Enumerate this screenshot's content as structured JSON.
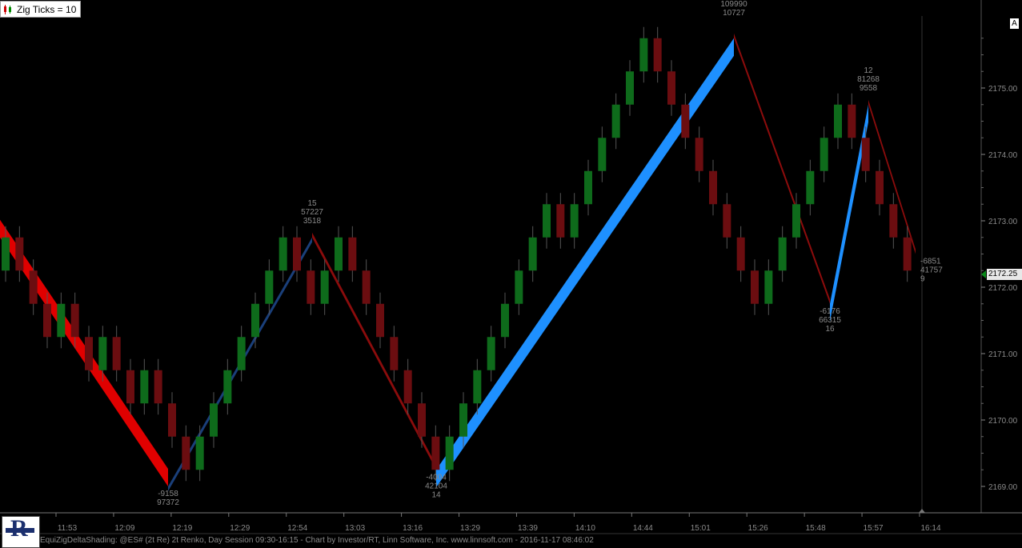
{
  "indicator": {
    "label": "Zig Ticks = 10"
  },
  "a_button": "A",
  "current_price": "2172.25",
  "footer": "EquiZigDeltaShading: @ES# (2t Re) 2t Renko, Day Session 09:30-16:15 - Chart by Investor/RT, Linn Software, Inc. www.linnsoft.com - 2016-11-17 08:46:02",
  "colors": {
    "up_brick": "#0e6b1b",
    "down_brick": "#6b0d10",
    "zig_down_bright": "#e00000",
    "zig_up_bright": "#1e90ff",
    "zig_down_dark": "#8b0c0c",
    "zig_up_dark": "#1a3f7a",
    "axis_text": "#8a8a8a"
  },
  "chart_data": {
    "type": "renko",
    "y_ticks": [
      "2175.00",
      "2174.00",
      "2173.00",
      "2172.00",
      "2171.00",
      "2170.00",
      "2169.00"
    ],
    "y_tick_values": [
      2175,
      2174,
      2173,
      2172,
      2171,
      2170,
      2169
    ],
    "x_ticks": [
      "11:53",
      "12:09",
      "12:19",
      "12:29",
      "12:54",
      "13:03",
      "13:16",
      "13:29",
      "13:39",
      "14:10",
      "14:44",
      "15:01",
      "15:26",
      "15:48",
      "15:57",
      "16:14"
    ],
    "ylim": [
      2168.6,
      2176.0
    ],
    "zig_points": [
      {
        "price": 2172.75,
        "labels": []
      },
      {
        "price": 2169.0,
        "labels": [
          "-9158",
          "97372"
        ]
      },
      {
        "price": 2172.75,
        "labels": [
          "15",
          "57227",
          "3518"
        ]
      },
      {
        "price": 2169.25,
        "labels": [
          "-4004",
          "42104",
          "14"
        ]
      },
      {
        "price": 2175.75,
        "labels": [
          "109990",
          "10727"
        ]
      },
      {
        "price": 2171.75,
        "labels": [
          "-6176",
          "66315",
          "16"
        ]
      },
      {
        "price": 2174.75,
        "labels": [
          "12",
          "81268",
          "9558"
        ]
      },
      {
        "price": 2172.5,
        "labels": [
          "-6851",
          "41757",
          "9"
        ]
      }
    ],
    "segments": [
      {
        "direction": "down",
        "intensity": "bright"
      },
      {
        "direction": "up",
        "intensity": "dark"
      },
      {
        "direction": "down",
        "intensity": "dark"
      },
      {
        "direction": "up",
        "intensity": "bright"
      },
      {
        "direction": "down",
        "intensity": "dark"
      },
      {
        "direction": "up",
        "intensity": "bright"
      },
      {
        "direction": "down",
        "intensity": "dark"
      }
    ],
    "bricks": [
      {
        "o": 2172.25,
        "c": 2172.75
      },
      {
        "o": 2172.75,
        "c": 2172.25
      },
      {
        "o": 2172.25,
        "c": 2171.75
      },
      {
        "o": 2171.75,
        "c": 2171.25
      },
      {
        "o": 2171.25,
        "c": 2171.75
      },
      {
        "o": 2171.75,
        "c": 2171.25
      },
      {
        "o": 2171.25,
        "c": 2170.75
      },
      {
        "o": 2170.75,
        "c": 2171.25
      },
      {
        "o": 2171.25,
        "c": 2170.75
      },
      {
        "o": 2170.75,
        "c": 2170.25
      },
      {
        "o": 2170.25,
        "c": 2170.75
      },
      {
        "o": 2170.75,
        "c": 2170.25
      },
      {
        "o": 2170.25,
        "c": 2169.75
      },
      {
        "o": 2169.75,
        "c": 2169.25
      },
      {
        "o": 2169.25,
        "c": 2169.75
      },
      {
        "o": 2169.75,
        "c": 2170.25
      },
      {
        "o": 2170.25,
        "c": 2170.75
      },
      {
        "o": 2170.75,
        "c": 2171.25
      },
      {
        "o": 2171.25,
        "c": 2171.75
      },
      {
        "o": 2171.75,
        "c": 2172.25
      },
      {
        "o": 2172.25,
        "c": 2172.75
      },
      {
        "o": 2172.75,
        "c": 2172.25
      },
      {
        "o": 2172.25,
        "c": 2171.75
      },
      {
        "o": 2171.75,
        "c": 2172.25
      },
      {
        "o": 2172.25,
        "c": 2172.75
      },
      {
        "o": 2172.75,
        "c": 2172.25
      },
      {
        "o": 2172.25,
        "c": 2171.75
      },
      {
        "o": 2171.75,
        "c": 2171.25
      },
      {
        "o": 2171.25,
        "c": 2170.75
      },
      {
        "o": 2170.75,
        "c": 2170.25
      },
      {
        "o": 2170.25,
        "c": 2169.75
      },
      {
        "o": 2169.75,
        "c": 2169.25
      },
      {
        "o": 2169.25,
        "c": 2169.75
      },
      {
        "o": 2169.75,
        "c": 2170.25
      },
      {
        "o": 2170.25,
        "c": 2170.75
      },
      {
        "o": 2170.75,
        "c": 2171.25
      },
      {
        "o": 2171.25,
        "c": 2171.75
      },
      {
        "o": 2171.75,
        "c": 2172.25
      },
      {
        "o": 2172.25,
        "c": 2172.75
      },
      {
        "o": 2172.75,
        "c": 2173.25
      },
      {
        "o": 2173.25,
        "c": 2172.75
      },
      {
        "o": 2172.75,
        "c": 2173.25
      },
      {
        "o": 2173.25,
        "c": 2173.75
      },
      {
        "o": 2173.75,
        "c": 2174.25
      },
      {
        "o": 2174.25,
        "c": 2174.75
      },
      {
        "o": 2174.75,
        "c": 2175.25
      },
      {
        "o": 2175.25,
        "c": 2175.75
      },
      {
        "o": 2175.75,
        "c": 2175.25
      },
      {
        "o": 2175.25,
        "c": 2174.75
      },
      {
        "o": 2174.75,
        "c": 2174.25
      },
      {
        "o": 2174.25,
        "c": 2173.75
      },
      {
        "o": 2173.75,
        "c": 2173.25
      },
      {
        "o": 2173.25,
        "c": 2172.75
      },
      {
        "o": 2172.75,
        "c": 2172.25
      },
      {
        "o": 2172.25,
        "c": 2171.75
      },
      {
        "o": 2171.75,
        "c": 2172.25
      },
      {
        "o": 2172.25,
        "c": 2172.75
      },
      {
        "o": 2172.75,
        "c": 2173.25
      },
      {
        "o": 2173.25,
        "c": 2173.75
      },
      {
        "o": 2173.75,
        "c": 2174.25
      },
      {
        "o": 2174.25,
        "c": 2174.75
      },
      {
        "o": 2174.75,
        "c": 2174.25
      },
      {
        "o": 2174.25,
        "c": 2173.75
      },
      {
        "o": 2173.75,
        "c": 2173.25
      },
      {
        "o": 2173.25,
        "c": 2172.75
      },
      {
        "o": 2172.75,
        "c": 2172.25
      }
    ]
  }
}
